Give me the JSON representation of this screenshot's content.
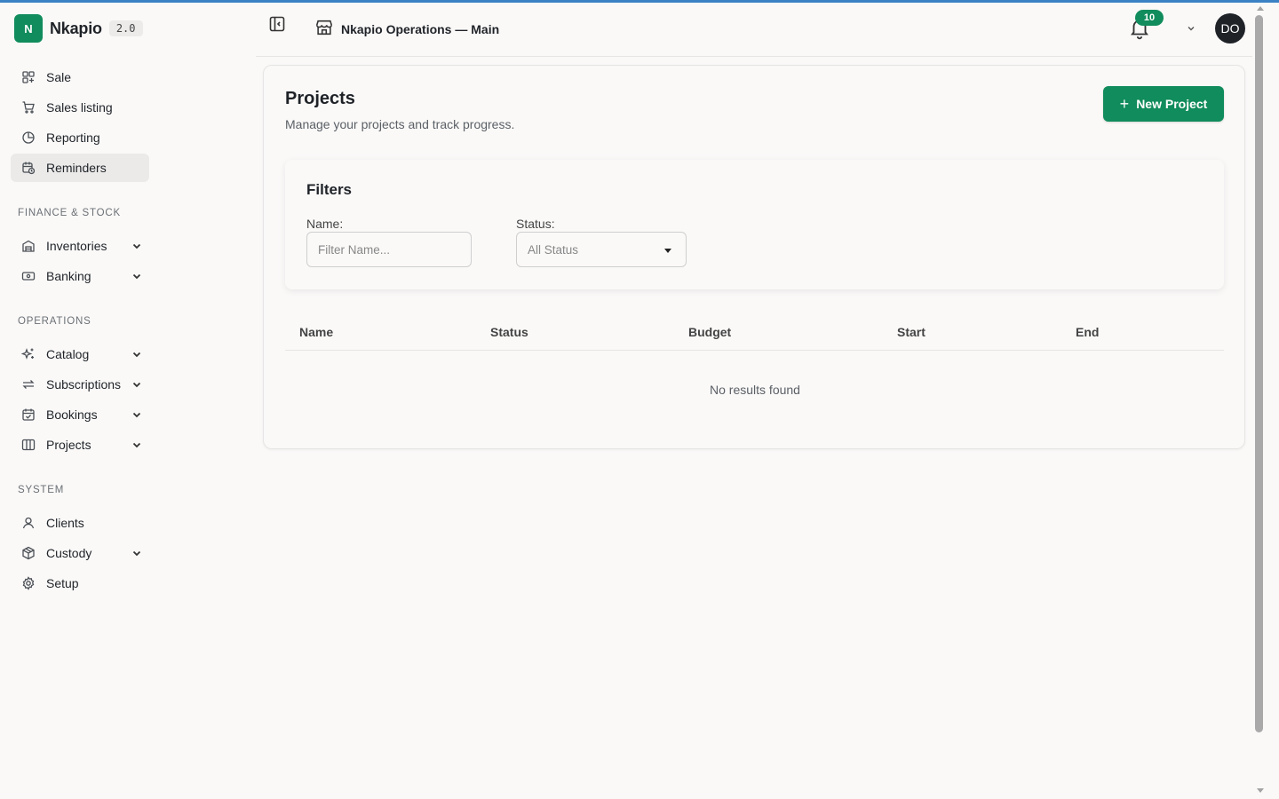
{
  "brand": {
    "initial": "N",
    "name": "Nkapio",
    "version": "2.0"
  },
  "sidebar": {
    "top_items": [
      {
        "label": "Sale",
        "icon": "layout-grid-plus-icon"
      },
      {
        "label": "Sales listing",
        "icon": "cart-icon"
      },
      {
        "label": "Reporting",
        "icon": "pie-chart-icon"
      },
      {
        "label": "Reminders",
        "icon": "calendar-clock-icon",
        "active": true
      }
    ],
    "sections": [
      {
        "label": "FINANCE & STOCK",
        "items": [
          {
            "label": "Inventories",
            "icon": "warehouse-icon",
            "expandable": true
          },
          {
            "label": "Banking",
            "icon": "banknote-icon",
            "expandable": true
          }
        ]
      },
      {
        "label": "OPERATIONS",
        "items": [
          {
            "label": "Catalog",
            "icon": "sparkles-icon",
            "expandable": true
          },
          {
            "label": "Subscriptions",
            "icon": "repeat-icon",
            "expandable": true
          },
          {
            "label": "Bookings",
            "icon": "calendar-check-icon",
            "expandable": true
          },
          {
            "label": "Projects",
            "icon": "kanban-icon",
            "expandable": true
          }
        ]
      },
      {
        "label": "SYSTEM",
        "items": [
          {
            "label": "Clients",
            "icon": "user-icon"
          },
          {
            "label": "Custody",
            "icon": "package-icon",
            "expandable": true
          },
          {
            "label": "Setup",
            "icon": "gear-icon"
          }
        ]
      }
    ]
  },
  "header": {
    "store_name": "Nkapio Operations — Main",
    "notification_count": "10",
    "avatar_initials": "DO"
  },
  "main": {
    "title": "Projects",
    "subtitle": "Manage your projects and track progress.",
    "new_button_label": "New Project",
    "filters": {
      "title": "Filters",
      "name_label": "Name:",
      "name_placeholder": "Filter Name...",
      "status_label": "Status:",
      "status_value": "All Status"
    },
    "table": {
      "columns": [
        "Name",
        "Status",
        "Budget",
        "Start",
        "End"
      ],
      "empty_text": "No results found"
    }
  },
  "colors": {
    "accent": "#118c5c",
    "background": "#faf9f8",
    "avatar": "#1f2328"
  }
}
